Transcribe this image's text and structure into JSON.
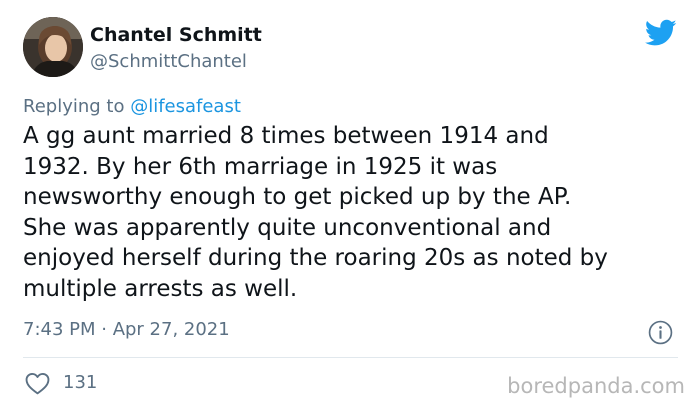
{
  "author": {
    "display_name": "Chantel Schmitt",
    "handle": "@SchmittChantel"
  },
  "reply": {
    "prefix": "Replying to ",
    "mention": "@lifesafeast"
  },
  "tweet": {
    "lines": [
      "A gg aunt married 8 times between 1914 and",
      "1932. By her 6th marriage in 1925 it was",
      "newsworthy enough to get picked up by the AP.",
      "She was apparently quite unconventional and",
      "enjoyed herself during the roaring 20s as noted by",
      "multiple arrests as well."
    ],
    "timestamp": "7:43 PM · Apr 27, 2021"
  },
  "engagement": {
    "likes": "131"
  },
  "icons": {
    "brand": "twitter-bird-icon",
    "info": "info-icon",
    "like": "heart-icon"
  },
  "colors": {
    "twitter_blue": "#1da1f2",
    "mention_blue": "#1b95e0",
    "secondary_text": "#5b7083",
    "primary_text": "#0f1419",
    "divider": "#e1e8ed",
    "watermark": "#b7b7b7"
  },
  "watermark": "boredpanda.com"
}
